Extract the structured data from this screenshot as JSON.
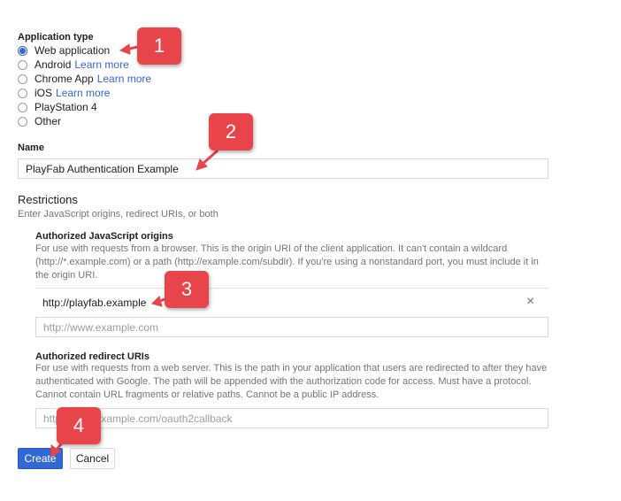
{
  "application_type": {
    "label": "Application type",
    "options": [
      {
        "label": "Web application",
        "link": "",
        "checked": true
      },
      {
        "label": "Android",
        "link": "Learn more",
        "checked": false
      },
      {
        "label": "Chrome App",
        "link": "Learn more",
        "checked": false
      },
      {
        "label": "iOS",
        "link": "Learn more",
        "checked": false
      },
      {
        "label": "PlayStation 4",
        "link": "",
        "checked": false
      },
      {
        "label": "Other",
        "link": "",
        "checked": false
      }
    ]
  },
  "name": {
    "label": "Name",
    "value": "PlayFab Authentication Example"
  },
  "restrictions": {
    "title": "Restrictions",
    "subtitle": "Enter JavaScript origins, redirect URIs, or both"
  },
  "js_origins": {
    "title": "Authorized JavaScript origins",
    "help_line1": "For use with requests from a browser. This is the origin URI of the client application. It can't contain a wildcard",
    "help_line2": "(http://*.example.com) or a path (http://example.com/subdir). If you're using a nonstandard port, you must include it in",
    "help_line3": "the origin URI.",
    "entry": "http://playfab.example",
    "remove_icon": "×",
    "placeholder": "http://www.example.com"
  },
  "redirect_uris": {
    "title": "Authorized redirect URIs",
    "help_line1": "For use with requests from a web server. This is the path in your application that users are redirected to after they have",
    "help_line2": "authenticated with Google. The path will be appended with the authorization code for access. Must have a protocol.",
    "help_line3": "Cannot contain URL fragments or relative paths. Cannot be a public IP address.",
    "placeholder": "http://www.example.com/oauth2callback"
  },
  "buttons": {
    "create": "Create",
    "cancel": "Cancel"
  },
  "callouts": [
    "1",
    "2",
    "3",
    "4"
  ],
  "colors": {
    "accent": "#3367d6",
    "callout": "#e8454a"
  }
}
